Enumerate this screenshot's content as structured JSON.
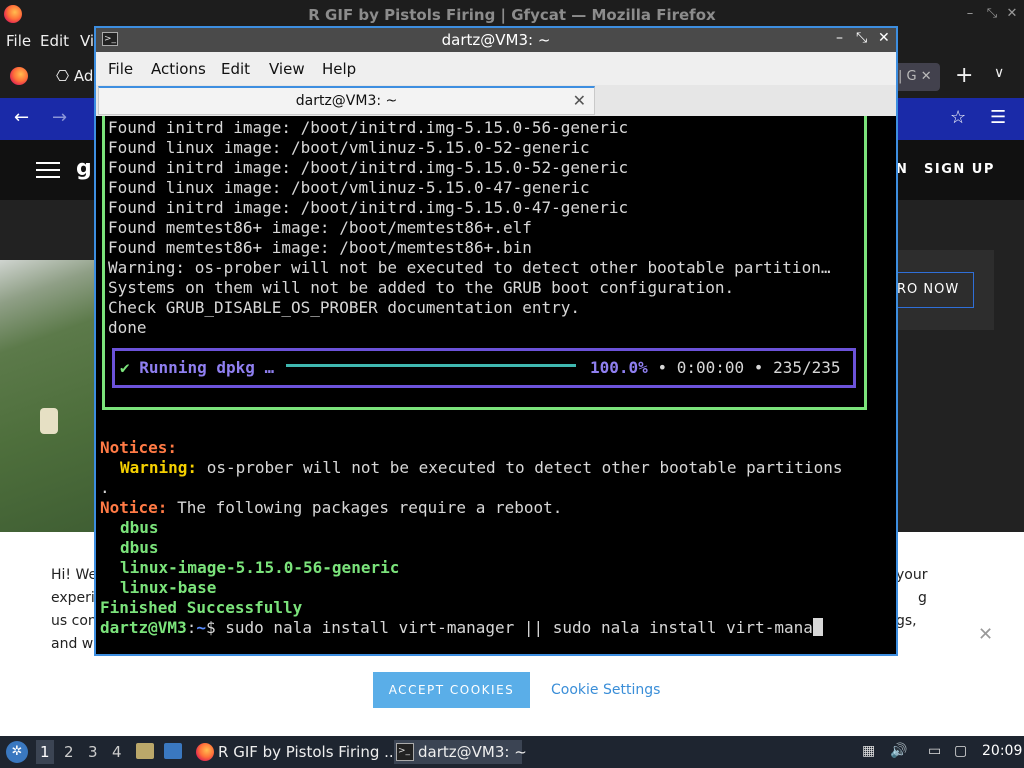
{
  "firefox": {
    "window_title": "R GIF by Pistols Firing | Gfycat — Mozilla Firefox",
    "menu": [
      "File",
      "Edit",
      "Vi"
    ],
    "addon_label": "Ad",
    "right_tab_label": "| G",
    "right_tab_close": "✕",
    "new_tab": "+",
    "list_tabs": "∨",
    "nav": {
      "back": "←",
      "forward": "→",
      "bookmark": "☆",
      "menu": "☰"
    }
  },
  "gfycat": {
    "logo": "g",
    "login_fragment": "N",
    "signup": "SIGN UP",
    "pro_button": "RO NOW"
  },
  "cookie_banner": {
    "left_lines": [
      "Hi! We",
      "experie",
      "us con",
      "and wi"
    ],
    "right_lines": [
      "your",
      "g",
      "gs,",
      ""
    ],
    "accept": "ACCEPT COOKIES",
    "settings": "Cookie Settings",
    "close": "✕"
  },
  "terminal": {
    "window_title": "dartz@VM3: ~",
    "menu": [
      "File",
      "Actions",
      "Edit",
      "View",
      "Help"
    ],
    "tab_label": "dartz@VM3: ~",
    "tab_close": "✕",
    "window_buttons": {
      "minimize": "–",
      "maximize": "⤡",
      "close": "✕"
    },
    "lines": [
      "Found initrd image: /boot/initrd.img-5.15.0-56-generic",
      "Found linux image: /boot/vmlinuz-5.15.0-52-generic",
      "Found initrd image: /boot/initrd.img-5.15.0-52-generic",
      "Found linux image: /boot/vmlinuz-5.15.0-47-generic",
      "Found initrd image: /boot/initrd.img-5.15.0-47-generic",
      "Found memtest86+ image: /boot/memtest86+.elf",
      "Found memtest86+ image: /boot/memtest86+.bin",
      "Warning: os-prober will not be executed to detect other bootable partition…",
      "Systems on them will not be added to the GRUB boot configuration.",
      "Check GRUB_DISABLE_OS_PROBER documentation entry.",
      "done"
    ],
    "progress": {
      "check": "✔",
      "label": "Running dpkg …",
      "percent": "100.0%",
      "bullet": "•",
      "elapsed": "0:00:00",
      "count": "235/235",
      "fraction": 1.0
    },
    "notices_label": "Notices:",
    "warning_label": "Warning:",
    "warning_text": " os-prober will not be executed to detect other bootable partitions",
    "warning_tail": ".",
    "notice_label": "Notice:",
    "notice_text": " The following packages require a reboot.",
    "packages": [
      "dbus",
      "dbus",
      "linux-image-5.15.0-56-generic",
      "linux-base"
    ],
    "finished": "Finished Successfully",
    "prompt_user": "dartz@VM3",
    "prompt_sep": ":",
    "prompt_path": "~",
    "prompt_symbol": "$",
    "command": " sudo nala install virt-manager || sudo nala install virt-mana"
  },
  "taskbar": {
    "workspaces": [
      "1",
      "2",
      "3",
      "4"
    ],
    "firefox_task": "R GIF by Pistols Firing ...",
    "terminal_task": "dartz@VM3: ~",
    "clock": "20:09"
  }
}
